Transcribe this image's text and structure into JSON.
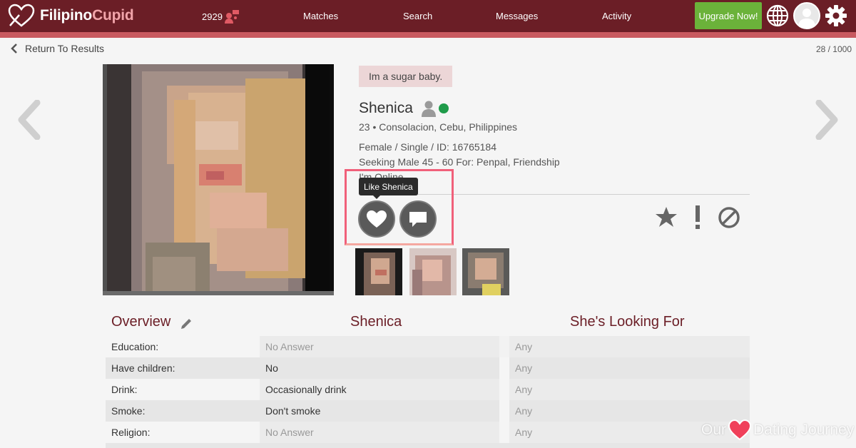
{
  "header": {
    "logo_prefix": "Filipino",
    "logo_suffix": "Cupid",
    "count": "2929",
    "nav": [
      "Matches",
      "Search",
      "Messages",
      "Activity"
    ],
    "upgrade_label": "Upgrade Now!",
    "icons": [
      "heart-logo-icon",
      "people-icon",
      "globe-icon",
      "avatar",
      "gear-icon"
    ]
  },
  "subheader": {
    "back_label": "Return To Results",
    "page_count": "28 / 1000"
  },
  "profile": {
    "headline": "Im a sugar baby.",
    "name": "Shenica",
    "age_location": "23 • Consolacion, Cebu, Philippines",
    "details": "Female / Single / ID: 16765184",
    "seeking": "Seeking Male 45 - 60 For: Penpal, Friendship",
    "online_status": "I'm Online",
    "tooltip": "Like Shenica",
    "photo_count": 3
  },
  "table": {
    "headers": [
      "Overview",
      "Shenica",
      "She's Looking For"
    ],
    "rows": [
      {
        "label": "Education:",
        "value": "No Answer",
        "looking": "Any"
      },
      {
        "label": "Have children:",
        "value": "No",
        "looking": "Any"
      },
      {
        "label": "Drink:",
        "value": "Occasionally drink",
        "looking": "Any"
      },
      {
        "label": "Smoke:",
        "value": "Don't smoke",
        "looking": "Any"
      },
      {
        "label": "Religion:",
        "value": "No Answer",
        "looking": "Any"
      }
    ]
  },
  "watermark": {
    "left": "Our",
    "right": "Dating Journey"
  },
  "colors": {
    "header_bg": "#6b1e26",
    "stripe": "#c85a60",
    "upgrade": "#6bb23a",
    "online": "#1f9b4a",
    "accent_text": "#6b1e26"
  }
}
